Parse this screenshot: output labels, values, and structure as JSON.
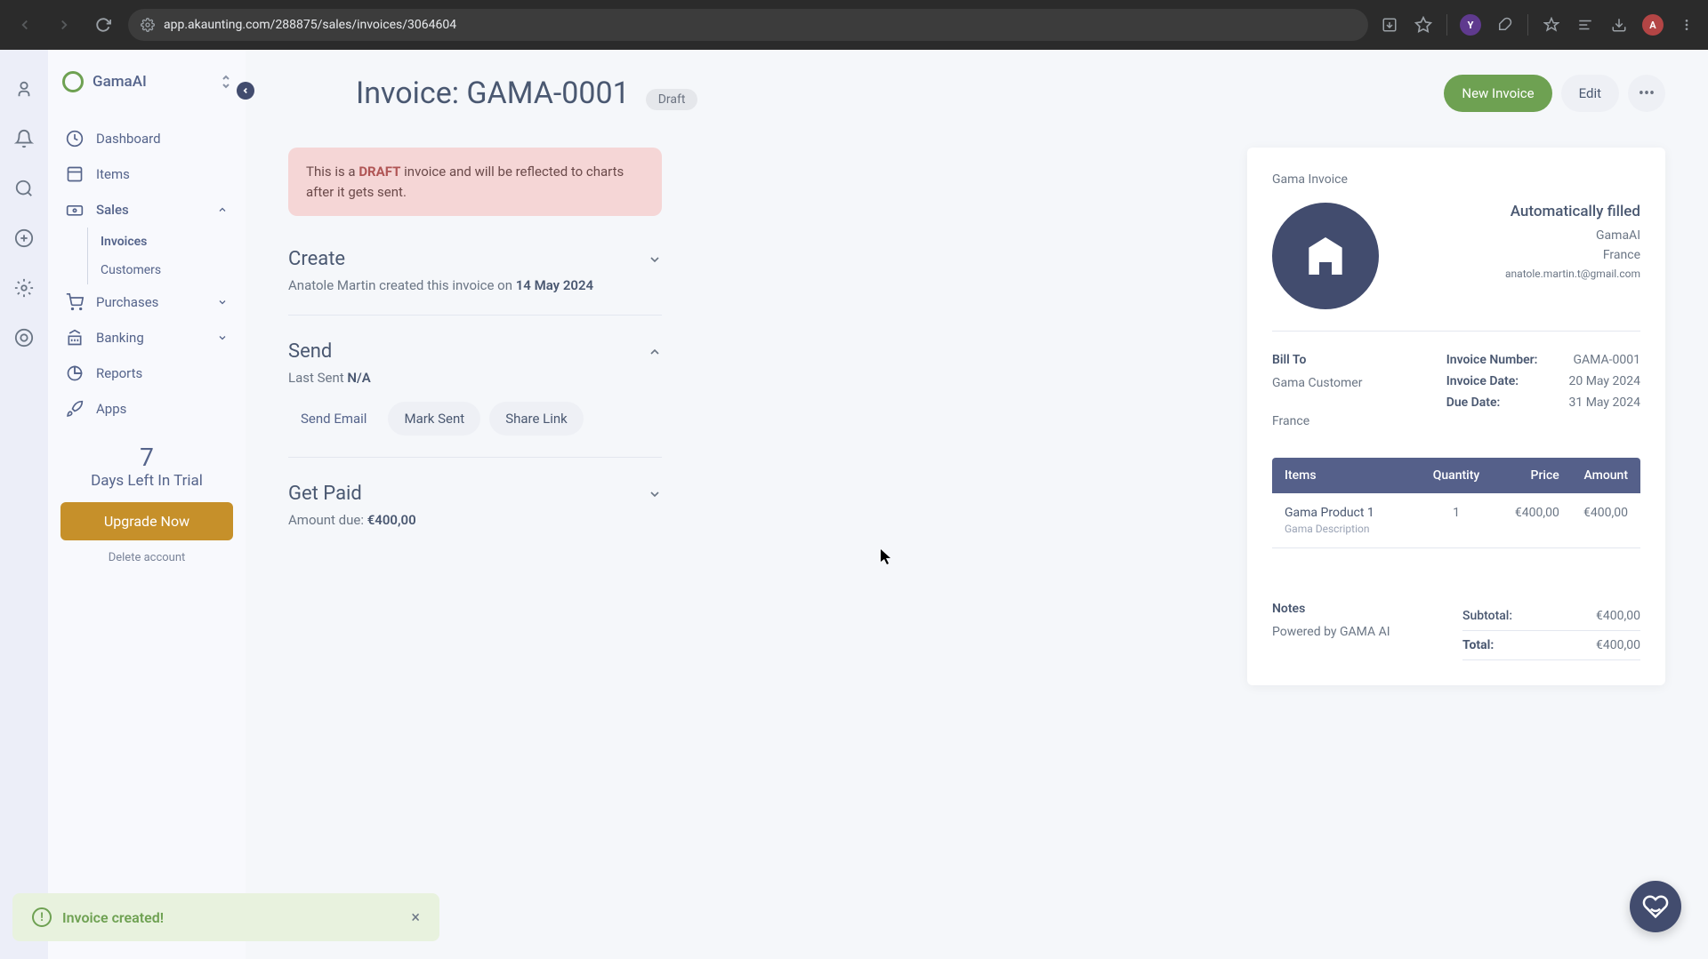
{
  "browser": {
    "url": "app.akaunting.com/288875/sales/invoices/3064604"
  },
  "company": {
    "name": "GamaAI"
  },
  "nav": {
    "dashboard": "Dashboard",
    "items": "Items",
    "sales": "Sales",
    "invoices": "Invoices",
    "customers": "Customers",
    "purchases": "Purchases",
    "banking": "Banking",
    "reports": "Reports",
    "apps": "Apps"
  },
  "trial": {
    "days": "7",
    "label": "Days Left In Trial",
    "upgrade": "Upgrade Now",
    "delete": "Delete account"
  },
  "header": {
    "title": "Invoice: GAMA-0001",
    "badge": "Draft",
    "new": "New Invoice",
    "edit": "Edit"
  },
  "alert": {
    "prefix": "This is a ",
    "strong": "DRAFT",
    "suffix": " invoice and will be reflected to charts after it gets sent."
  },
  "sections": {
    "create": {
      "title": "Create",
      "text_prefix": "Anatole Martin created this invoice on ",
      "date": "14 May 2024"
    },
    "send": {
      "title": "Send",
      "last_prefix": "Last Sent ",
      "last_val": "N/A",
      "send_email": "Send Email",
      "mark_sent": "Mark Sent",
      "share_link": "Share Link"
    },
    "paid": {
      "title": "Get Paid",
      "due_prefix": "Amount due: ",
      "due_val": "€400,00"
    }
  },
  "invoice": {
    "heading": "Gama Invoice",
    "filled": "Automatically filled",
    "org": "GamaAI",
    "country": "France",
    "email": "anatole.martin.t@gmail.com",
    "bill_label": "Bill To",
    "bill_customer": "Gama Customer",
    "bill_country": "France",
    "num_label": "Invoice Number:",
    "num_val": "GAMA-0001",
    "date_label": "Invoice Date:",
    "date_val": "20 May 2024",
    "due_label": "Due Date:",
    "due_val": "31 May 2024",
    "col_items": "Items",
    "col_qty": "Quantity",
    "col_price": "Price",
    "col_amt": "Amount",
    "line_name": "Gama Product 1",
    "line_desc": "Gama Description",
    "line_qty": "1",
    "line_price": "€400,00",
    "line_amt": "€400,00",
    "notes_label": "Notes",
    "notes_val": "Powered by GAMA AI",
    "subtotal_label": "Subtotal:",
    "subtotal_val": "€400,00",
    "total_label": "Total:",
    "total_val": "€400,00"
  },
  "toast": {
    "msg": "Invoice created!"
  }
}
